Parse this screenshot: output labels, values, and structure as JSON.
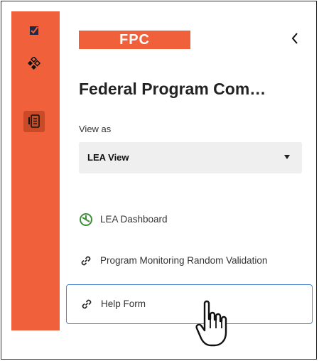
{
  "logo": {
    "text": "FPC"
  },
  "panel": {
    "title": "Federal Program Com…"
  },
  "view_as": {
    "label": "View as",
    "selected": "LEA View"
  },
  "rail": {
    "items": [
      "checkbox-icon",
      "diamond-grid-icon",
      "document-icon"
    ]
  },
  "nav": {
    "items": [
      {
        "label": "LEA Dashboard",
        "icon": "dashboard-icon"
      },
      {
        "label": "Program Monitoring Random Validation",
        "icon": "link-icon"
      },
      {
        "label": "Help Form",
        "icon": "link-icon"
      }
    ]
  },
  "colors": {
    "brand": "#f0613b",
    "active_rail": "#c84a27",
    "focus": "#4a86d4",
    "dashboard_icon": "#3f8f3a"
  }
}
